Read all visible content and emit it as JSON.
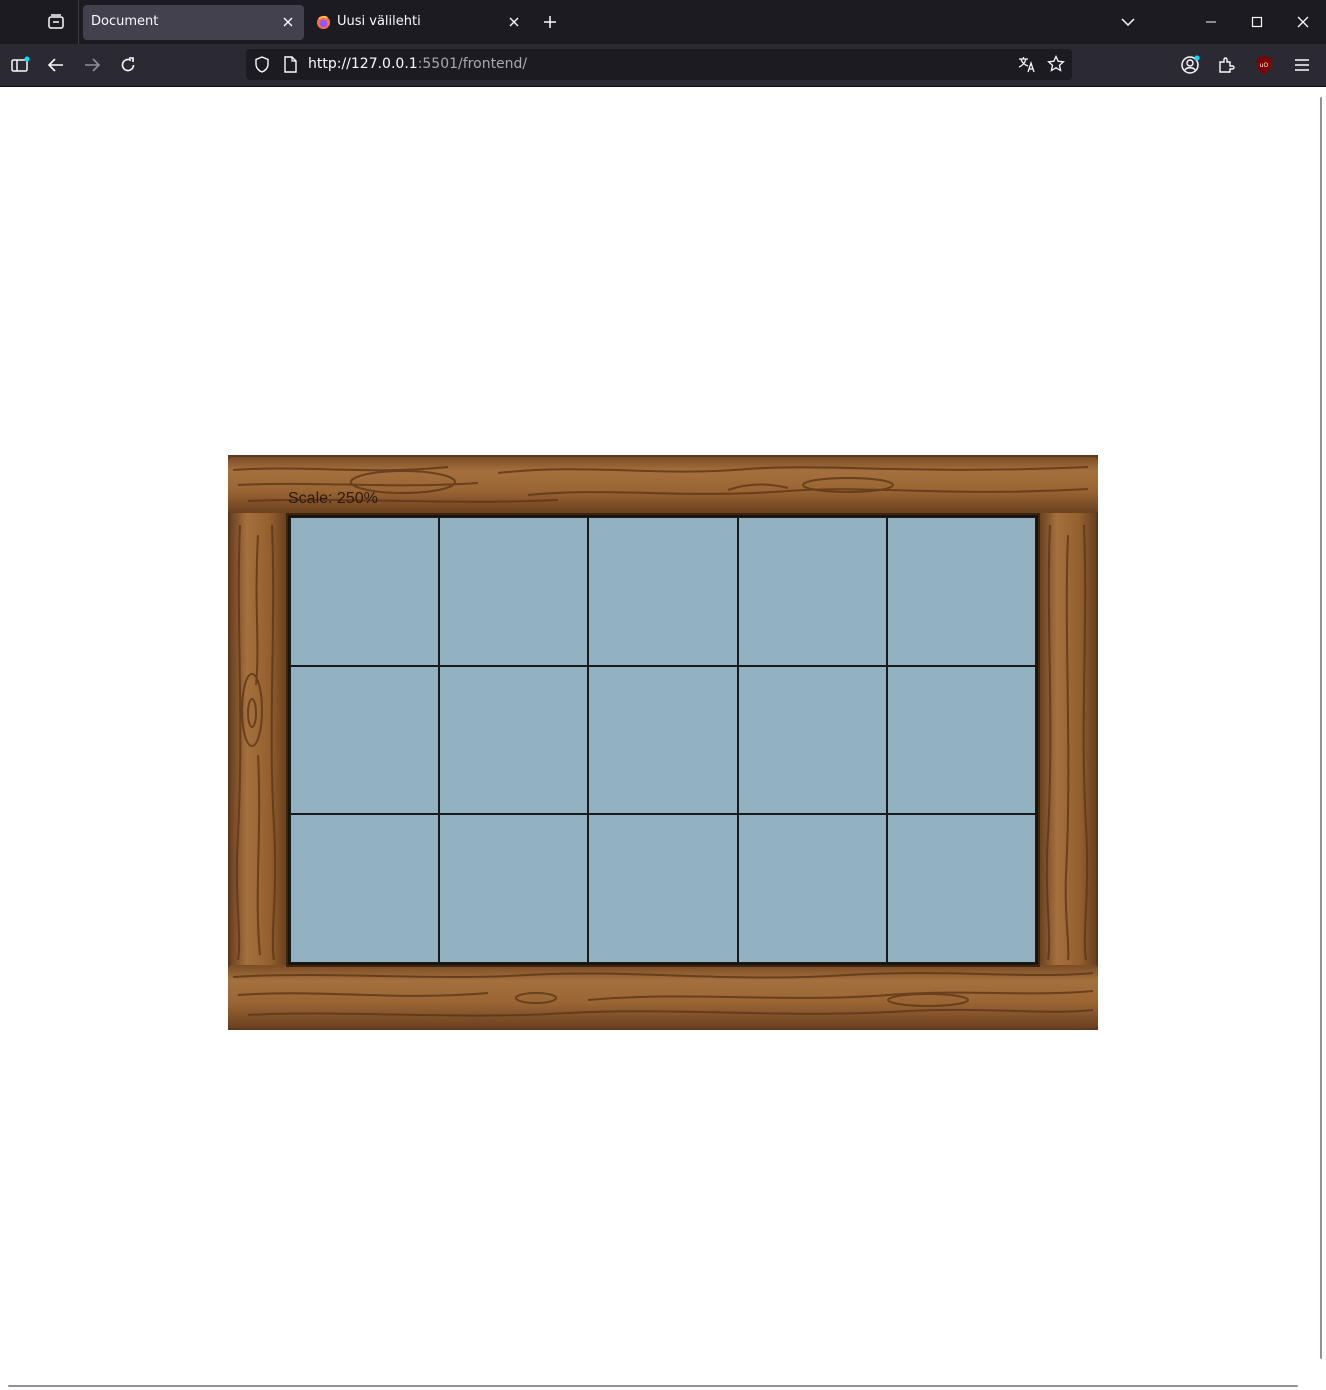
{
  "browser": {
    "tabs": [
      {
        "title": "Document",
        "active": true
      },
      {
        "title": "Uusi välilehti",
        "active": false
      }
    ],
    "url": {
      "host": "http://127.0.0.1",
      "rest": ":5501/frontend/"
    }
  },
  "game": {
    "scale_label": "Scale: 250%",
    "grid": {
      "rows": 3,
      "columns": 5
    },
    "colors": {
      "cell": "#92b1c1",
      "wood": "#8a5a2e",
      "grid_line": "#1a1a1a"
    }
  },
  "icons": [
    "tab-overview-icon",
    "close-icon",
    "firefox-icon",
    "plus-icon",
    "chevron-down-icon",
    "minimize-icon",
    "maximize-icon",
    "sidebar-icon",
    "back-arrow-icon",
    "forward-arrow-icon",
    "reload-icon",
    "shield-icon",
    "page-icon",
    "translate-icon",
    "star-icon",
    "account-icon",
    "extensions-icon",
    "ublock-icon",
    "menu-icon"
  ]
}
